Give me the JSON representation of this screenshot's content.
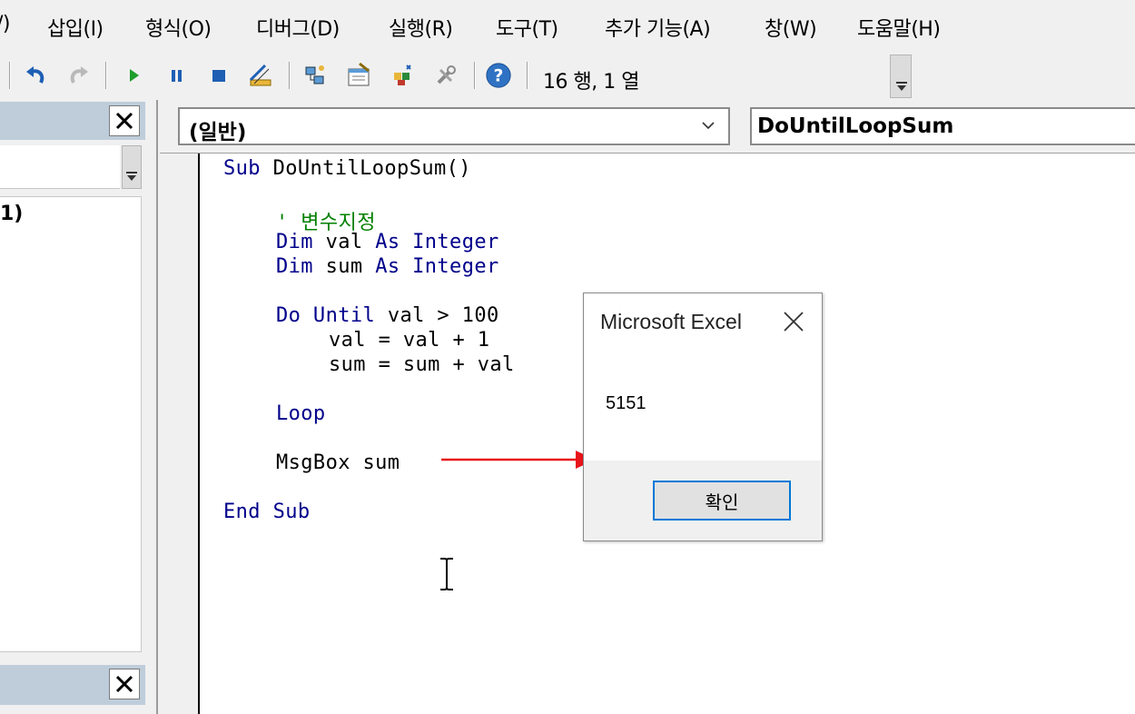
{
  "menu": {
    "items": [
      {
        "label": "/)"
      },
      {
        "label": "삽입(I)"
      },
      {
        "label": "형식(O)"
      },
      {
        "label": "디버그(D)"
      },
      {
        "label": "실행(R)"
      },
      {
        "label": "도구(T)"
      },
      {
        "label": "추가 기능(A)"
      },
      {
        "label": "창(W)"
      },
      {
        "label": "도움말(H)"
      }
    ]
  },
  "toolbar": {
    "icons": [
      "undo-icon",
      "redo-icon",
      "run-icon",
      "break-icon",
      "reset-icon",
      "design-mode-icon",
      "project-explorer-icon",
      "properties-window-icon",
      "object-browser-icon",
      "toolbox-icon",
      "help-icon"
    ],
    "position_text": "16 행, 1 열"
  },
  "project_pane": {
    "tree_text": "1)"
  },
  "code_window": {
    "object_combo": "(일반)",
    "procedure_combo": "DoUntilLoopSum",
    "lines": [
      {
        "kw1": "Sub ",
        "tx1": "DoUntilLoopSum()"
      },
      {
        "cm": "' 변수지정"
      },
      {
        "kw1": "Dim ",
        "tx1": "val ",
        "kw2": "As Integer"
      },
      {
        "kw1": "Dim ",
        "tx1": "sum ",
        "kw2": "As Integer"
      },
      {
        "kw1": "Do Until ",
        "tx1": "val > 100"
      },
      {
        "tx1": "val = val + 1"
      },
      {
        "tx1": "sum = sum + val"
      },
      {
        "kw1": "Loop"
      },
      {
        "tx1": "MsgBox sum"
      },
      {
        "kw1": "End Sub"
      }
    ]
  },
  "msgbox": {
    "title": "Microsoft Excel",
    "message": "5151",
    "ok_label": "확인"
  },
  "colors": {
    "keyword": "#00008b",
    "comment": "#008000",
    "pane_header": "#bfcddb",
    "arrow": "#e8141b",
    "focus": "#0078d7"
  }
}
